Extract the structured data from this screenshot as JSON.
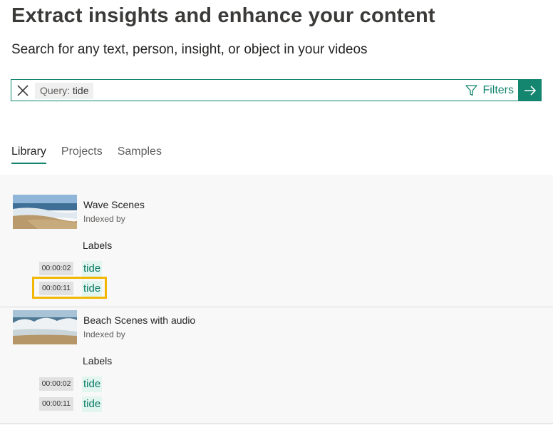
{
  "header": {
    "title": "Extract insights and enhance your content",
    "subtitle": "Search for any text, person, insight, or object in your videos"
  },
  "search": {
    "query_key": "Query:",
    "query_value": "tide",
    "filters_label": "Filters",
    "clear_icon": "close-icon",
    "filter_icon": "filter-icon",
    "submit_icon": "arrow-right-icon"
  },
  "tabs": [
    {
      "label": "Library",
      "active": true
    },
    {
      "label": "Projects",
      "active": false
    },
    {
      "label": "Samples",
      "active": false
    }
  ],
  "results": [
    {
      "title": "Wave Scenes",
      "subtitle": "Indexed by",
      "labels_heading": "Labels",
      "matches": [
        {
          "time": "00:00:02",
          "tag": "tide"
        },
        {
          "time": "00:00:11",
          "tag": "tide",
          "highlighted": true
        }
      ]
    },
    {
      "title": "Beach Scenes with audio",
      "subtitle": "Indexed by",
      "labels_heading": "Labels",
      "matches": [
        {
          "time": "00:00:02",
          "tag": "tide"
        },
        {
          "time": "00:00:11",
          "tag": "tide"
        }
      ]
    }
  ],
  "colors": {
    "accent": "#14856f",
    "tag_background": "#e2f5ef",
    "highlight": "#f2b705"
  }
}
